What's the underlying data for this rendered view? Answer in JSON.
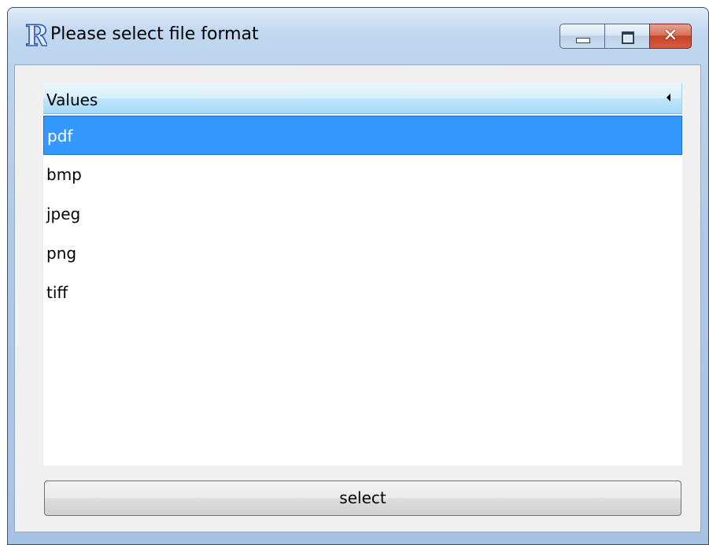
{
  "window": {
    "title": "Please select file format",
    "app_icon_letter": "R",
    "caption": {
      "minimize_icon": "minimize-icon",
      "maximize_icon": "maximize-icon",
      "close_icon": "close-icon",
      "close_glyph": "✕"
    }
  },
  "list": {
    "header_label": "Values",
    "sort_icon": "sort-arrow-icon",
    "items": [
      "pdf",
      "bmp",
      "jpeg",
      "png",
      "tiff"
    ],
    "selected": "pdf"
  },
  "select_button_label": "select",
  "colors": {
    "selection": "#3399ff",
    "header_gradient_top": "#eaf6fd",
    "header_gradient_bottom": "#a7d9f5",
    "close_button": "#c5432a"
  }
}
